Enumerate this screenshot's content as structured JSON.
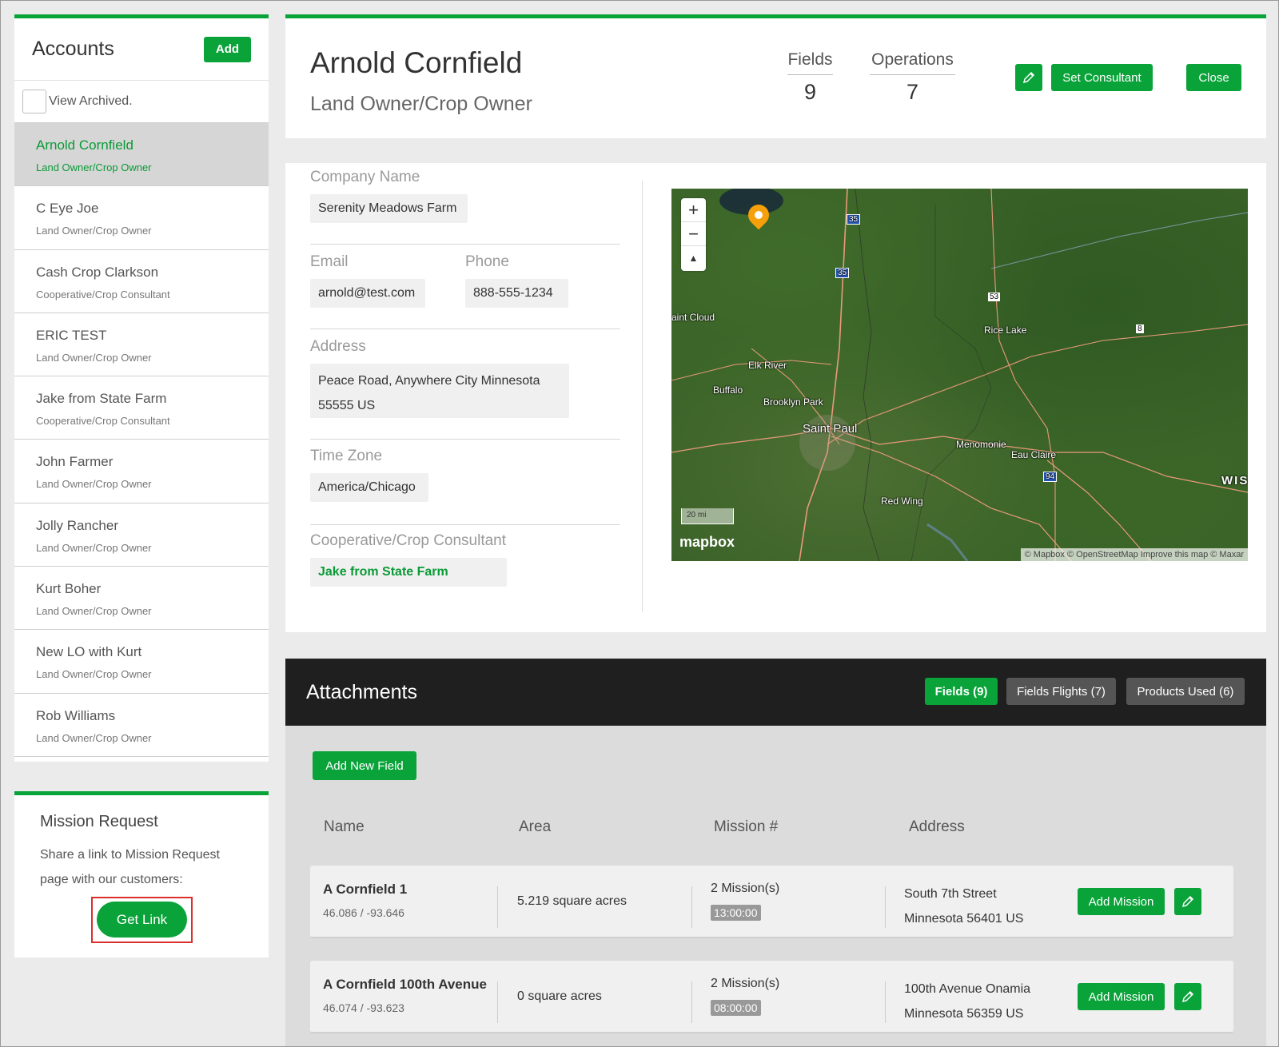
{
  "sidebar": {
    "title": "Accounts",
    "add_label": "Add",
    "view_archived_label": "View Archived.",
    "accounts": [
      {
        "name": "Arnold Cornfield",
        "role": "Land Owner/Crop Owner",
        "active": true
      },
      {
        "name": "C Eye Joe",
        "role": "Land Owner/Crop Owner"
      },
      {
        "name": "Cash Crop Clarkson",
        "role": "Cooperative/Crop Consultant"
      },
      {
        "name": "ERIC TEST",
        "role": "Land Owner/Crop Owner"
      },
      {
        "name": "Jake from State Farm",
        "role": "Cooperative/Crop Consultant"
      },
      {
        "name": "John Farmer",
        "role": "Land Owner/Crop Owner"
      },
      {
        "name": "Jolly Rancher",
        "role": "Land Owner/Crop Owner"
      },
      {
        "name": "Kurt Boher",
        "role": "Land Owner/Crop Owner"
      },
      {
        "name": "New LO with Kurt",
        "role": "Land Owner/Crop Owner"
      },
      {
        "name": "Rob Williams",
        "role": "Land Owner/Crop Owner"
      }
    ]
  },
  "mission_request": {
    "title": "Mission Request",
    "text": "Share a link to Mission Request page with our customers:",
    "button_label": "Get Link"
  },
  "header": {
    "name": "Arnold Cornfield",
    "role": "Land Owner/Crop Owner",
    "fields_label": "Fields",
    "fields_value": "9",
    "operations_label": "Operations",
    "operations_value": "7",
    "set_consultant_label": "Set Consultant",
    "close_label": "Close"
  },
  "details": {
    "company_label": "Company Name",
    "company_value": "Serenity Meadows Farm",
    "email_label": "Email",
    "email_value": "arnold@test.com",
    "phone_label": "Phone",
    "phone_value": "888-555-1234",
    "address_label": "Address",
    "address_value": "Peace Road, Anywhere City Minnesota 55555 US",
    "timezone_label": "Time Zone",
    "timezone_value": "America/Chicago",
    "consultant_label": "Cooperative/Crop Consultant",
    "consultant_value": "Jake from State Farm"
  },
  "map": {
    "zoom_in": "+",
    "zoom_out": "−",
    "compass": "▲",
    "cities": [
      "aint Cloud",
      "Elk River",
      "Buffalo",
      "Brooklyn Park",
      "Saint Paul",
      "Rice Lake",
      "Menomonie",
      "Eau Claire",
      "Red Wing",
      "WIS"
    ],
    "shields": [
      "35",
      "35",
      "53",
      "8",
      "94"
    ],
    "scale_label": "20 mi",
    "logo": "mapbox",
    "attribution": "© Mapbox © OpenStreetMap Improve this map © Maxar"
  },
  "attachments": {
    "title": "Attachments",
    "tabs": [
      "Fields (9)",
      "Fields Flights (7)",
      "Products Used (6)"
    ],
    "add_field_label": "Add New Field",
    "columns": [
      "Name",
      "Area",
      "Mission #",
      "Address"
    ],
    "add_mission_label": "Add Mission",
    "rows": [
      {
        "name": "A Cornfield 1",
        "coords": "46.086 / -93.646",
        "area": "5.219 square acres",
        "missions": "2 Mission(s)",
        "time": "13:00:00",
        "addr1": "South 7th Street",
        "addr2": "Minnesota 56401 US"
      },
      {
        "name": "A Cornfield 100th Avenue",
        "coords": "46.074 / -93.623",
        "area": "0 square acres",
        "missions": "2 Mission(s)",
        "time": "08:00:00",
        "addr1": "100th Avenue Onamia",
        "addr2": "Minnesota 56359 US"
      }
    ]
  },
  "colors": {
    "accent": "#0aa33a",
    "active_bg": "#d6d6d6",
    "dark_header": "#1f1f1f",
    "highlight": "#d9302c"
  }
}
